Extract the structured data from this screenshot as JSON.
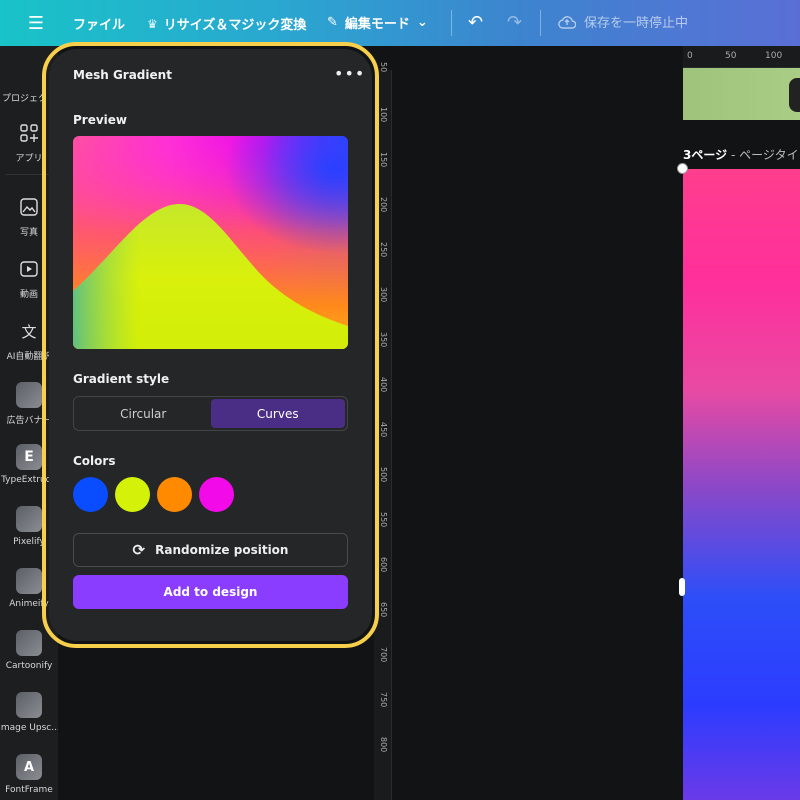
{
  "topbar": {
    "menu_icon": "hamburger-icon",
    "file": "ファイル",
    "resize": "リサイズ＆マジック変換",
    "edit_mode": "編集モード",
    "save_status": "保存を一時停止中"
  },
  "sidebar": {
    "items": [
      {
        "label": "プロジェクト",
        "icon": "folder-icon"
      },
      {
        "label": "アプリ",
        "icon": "apps-grid-icon"
      },
      {
        "label": "写真",
        "icon": "photo-icon"
      },
      {
        "label": "動画",
        "icon": "video-icon"
      },
      {
        "label": "AI自動翻訳",
        "icon": "translate-icon"
      },
      {
        "label": "広告バナー",
        "icon": "app-thumbnail"
      },
      {
        "label": "TypeExtrude",
        "icon": "app-thumbnail"
      },
      {
        "label": "Pixelify",
        "icon": "app-thumbnail"
      },
      {
        "label": "Animeify",
        "icon": "app-thumbnail"
      },
      {
        "label": "Cartoonify",
        "icon": "app-thumbnail"
      },
      {
        "label": "Image Upsc...",
        "icon": "app-thumbnail"
      },
      {
        "label": "FontFrame",
        "icon": "app-thumbnail"
      }
    ]
  },
  "panel": {
    "title": "Mesh Gradient",
    "preview_label": "Preview",
    "gradient_style_label": "Gradient style",
    "styles": [
      "Circular",
      "Curves"
    ],
    "selected_style": "Curves",
    "colors_label": "Colors",
    "colors": [
      "#0a4cff",
      "#d4f10a",
      "#ff8a00",
      "#f30ae9"
    ],
    "randomize_label": "Randomize position",
    "add_label": "Add to design"
  },
  "canvas": {
    "page_label_number": "3ページ",
    "page_label_title": " - ページタイ",
    "ruler_h": [
      "0",
      "50",
      "100"
    ],
    "ruler_v": [
      "50",
      "100",
      "150",
      "200",
      "250",
      "300",
      "350",
      "400",
      "450",
      "500",
      "550",
      "600",
      "650",
      "700",
      "750",
      "800"
    ]
  }
}
